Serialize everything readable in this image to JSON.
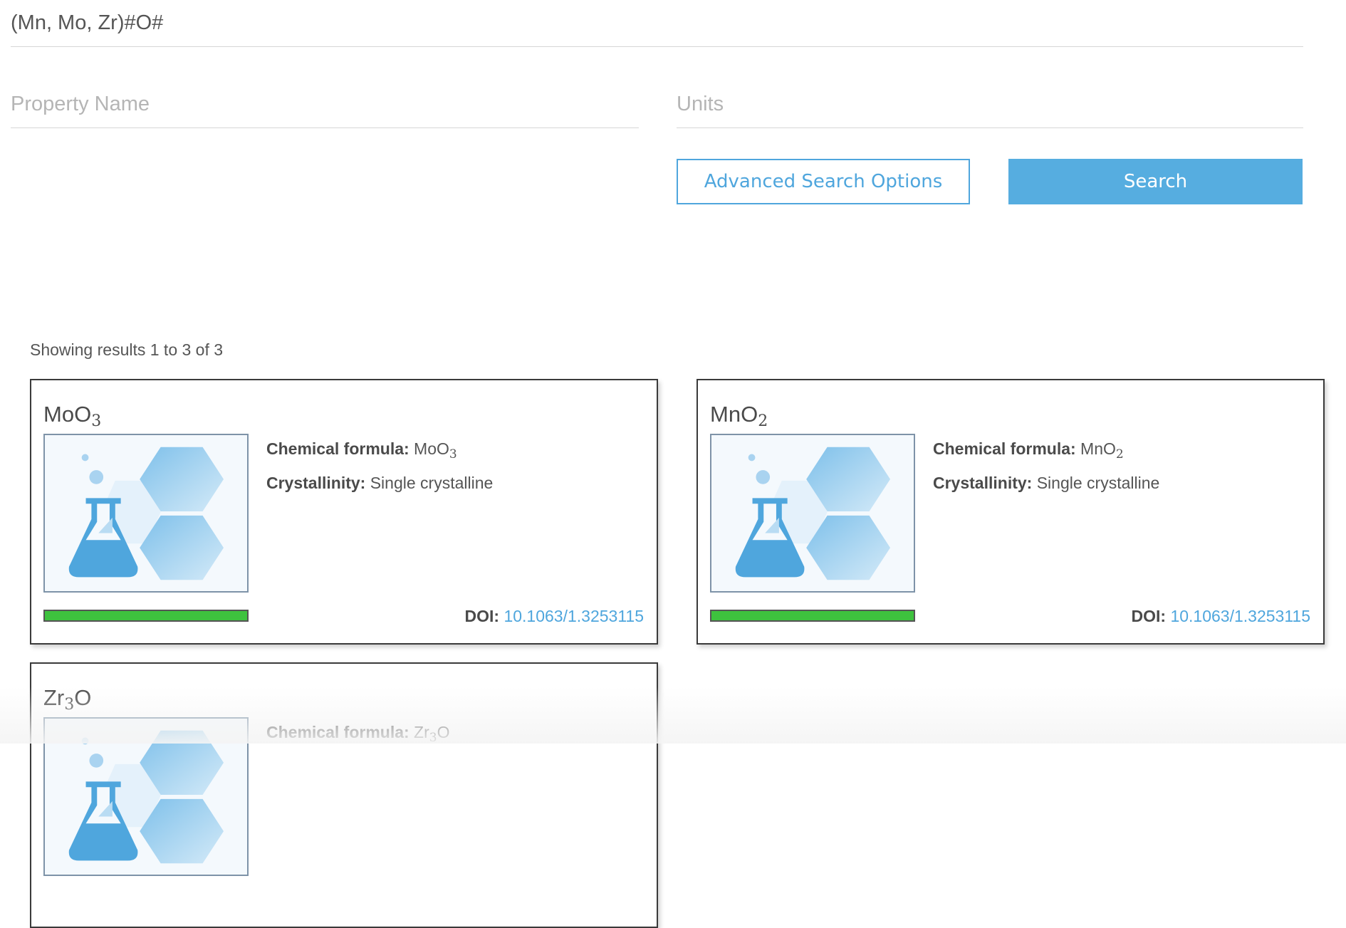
{
  "search": {
    "formula_value": "(Mn, Mo, Zr)#O#",
    "property_placeholder": "Property Name",
    "units_placeholder": "Units",
    "advanced_label": "Advanced Search Options",
    "search_label": "Search"
  },
  "results": {
    "summary": "Showing results 1 to 3 of 3",
    "items": [
      {
        "title_base": "MoO",
        "title_sub": "3",
        "formula_key": "Chemical formula:",
        "formula_base": "MoO",
        "formula_sub": "3",
        "crystallinity_key": "Crystallinity:",
        "crystallinity_value": "Single crystalline",
        "doi_key": "DOI:",
        "doi_value": "10.1063/1.3253115",
        "progress": 1.0
      },
      {
        "title_base": "MnO",
        "title_sub": "2",
        "formula_key": "Chemical formula:",
        "formula_base": "MnO",
        "formula_sub": "2",
        "crystallinity_key": "Crystallinity:",
        "crystallinity_value": "Single crystalline",
        "doi_key": "DOI:",
        "doi_value": "10.1063/1.3253115",
        "progress": 1.0
      },
      {
        "title_base": "Zr",
        "title_sub": "3",
        "title_tail": "O",
        "formula_key": "Chemical formula:",
        "formula_base": "Zr",
        "formula_sub": "3",
        "formula_tail": "O"
      }
    ]
  },
  "colors": {
    "accent": "#56ade0",
    "progress_fill": "#3ec23e",
    "card_border": "#3a3a3a"
  },
  "icons": {
    "thumbnail": "flask-hexagon-icon"
  }
}
